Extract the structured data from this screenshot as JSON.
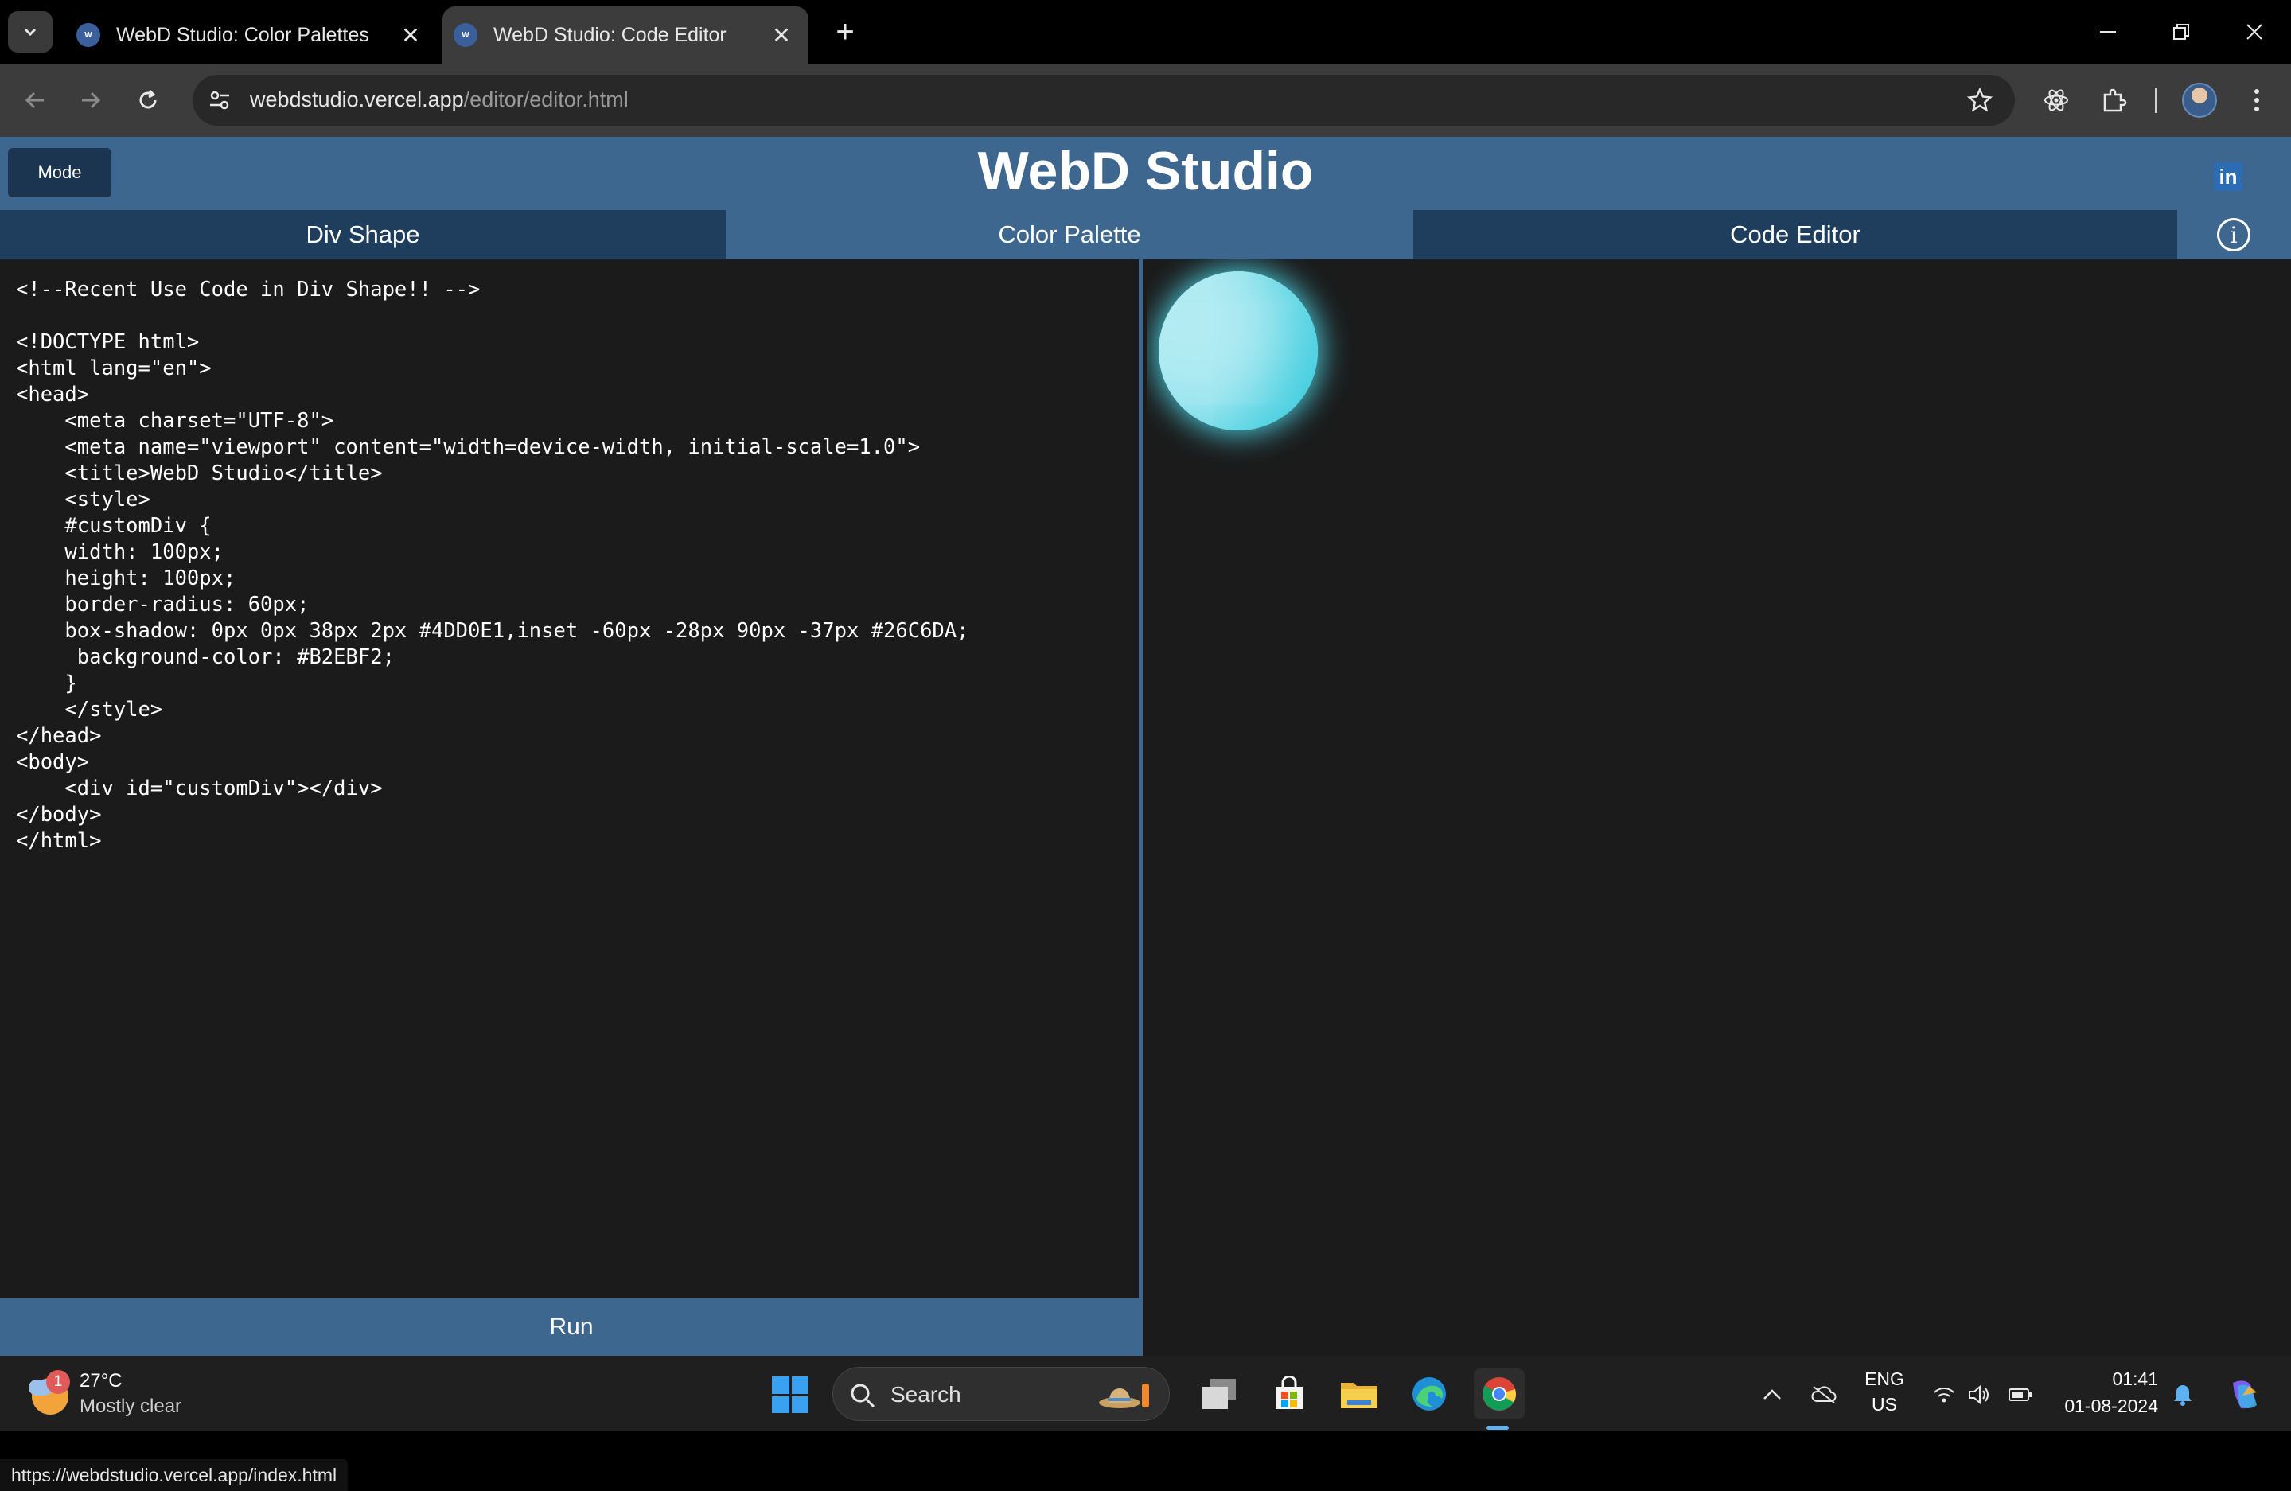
{
  "browser": {
    "tabs": [
      {
        "title": "WebD Studio: Color Palettes",
        "active": false
      },
      {
        "title": "WebD Studio: Code Editor",
        "active": true
      }
    ],
    "url_host": "webdstudio.vercel.app",
    "url_path": "/editor/editor.html",
    "status_url": "https://webdstudio.vercel.app/index.html"
  },
  "app": {
    "title": "WebD Studio",
    "mode_label": "Mode",
    "linkedin_label": "in",
    "info_label": "i",
    "nav": [
      {
        "label": "Div Shape"
      },
      {
        "label": "Color Palette"
      },
      {
        "label": "Code Editor"
      }
    ],
    "run_label": "Run"
  },
  "editor": {
    "code": "<!--Recent Use Code in Div Shape!! -->\n\n<!DOCTYPE html>\n<html lang=\"en\">\n<head>\n    <meta charset=\"UTF-8\">\n    <meta name=\"viewport\" content=\"width=device-width, initial-scale=1.0\">\n    <title>WebD Studio</title>\n    <style>\n    #customDiv {\n    width: 100px;\n    height: 100px;\n    border-radius: 60px;\n    box-shadow: 0px 0px 38px 2px #4DD0E1,inset -60px -28px 90px -37px #26C6DA;\n     background-color: #B2EBF2;\n    }\n    </style>\n</head>\n<body>\n    <div id=\"customDiv\"></div>\n</body>\n</html>"
  },
  "colors": {
    "header_bg": "#3e6790",
    "nav_dark": "#1f3e5d",
    "editor_bg": "#1b1b1b",
    "div_bg": "#B2EBF2",
    "div_glow": "#4DD0E1",
    "div_inset": "#26C6DA"
  },
  "taskbar": {
    "weather_badge": "1",
    "temperature": "27°C",
    "condition": "Mostly clear",
    "search_label": "Search",
    "lang": "ENG",
    "region": "US",
    "time": "01:41",
    "date": "01-08-2024"
  }
}
